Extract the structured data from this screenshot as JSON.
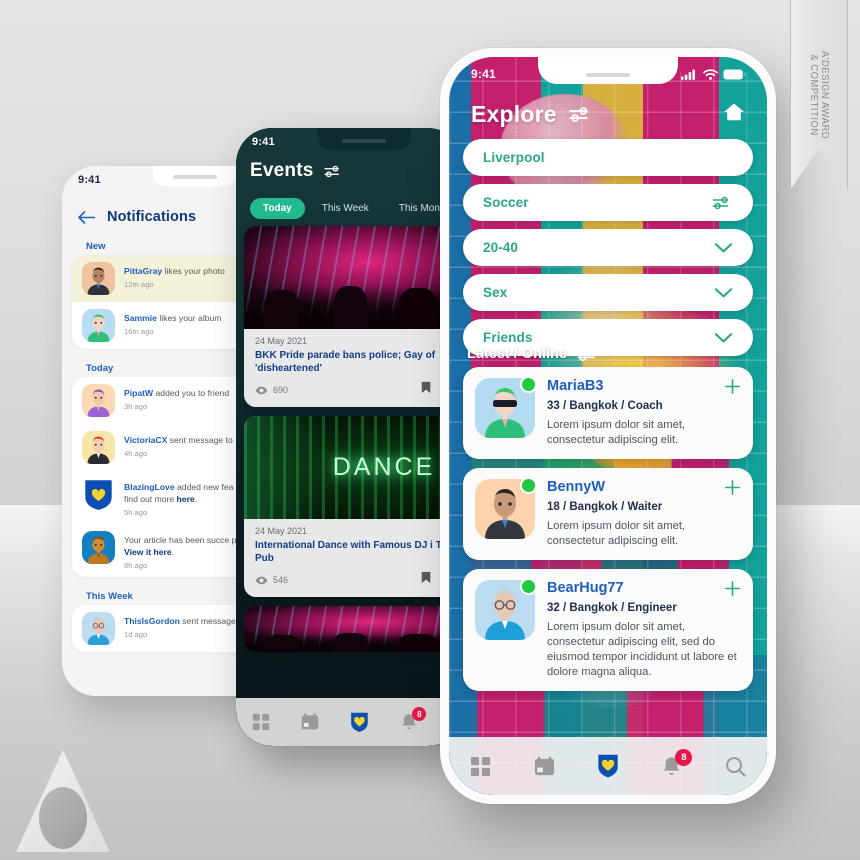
{
  "award_ribbon": {
    "line1": "A'DESIGN AWARD",
    "line2": "& COMPETITION"
  },
  "brand_logo": "a-logo",
  "phone_notifications": {
    "status_time": "9:41",
    "back_icon": "back-arrow-icon",
    "title": "Notifications",
    "sections": [
      {
        "label": "New",
        "items": [
          {
            "actor": "PittaGray",
            "text": " likes your photo",
            "time": "12m ago",
            "avatar": "avatar-businessman",
            "highlight": true,
            "link": "",
            "tail": ""
          },
          {
            "actor": "Sammie",
            "text": " likes your album",
            "time": "16m ago",
            "avatar": "avatar-green-hair",
            "highlight": false,
            "link": "",
            "tail": ""
          }
        ]
      },
      {
        "label": "Today",
        "items": [
          {
            "actor": "PipatW",
            "text": " added you to friend",
            "time": "3h ago",
            "avatar": "avatar-purple-glasses",
            "highlight": false,
            "link": "",
            "tail": ""
          },
          {
            "actor": "VictoriaCX",
            "text": " sent message to",
            "time": "4h ago",
            "avatar": "avatar-red-cap",
            "highlight": false,
            "link": "",
            "tail": ""
          },
          {
            "actor": "BlazingLove",
            "text": " added new fea",
            "time": "5h ago",
            "avatar": "avatar-app-shield",
            "highlight": false,
            "link": "here",
            "tail": "find out more ",
            "tail_end": "."
          },
          {
            "actor": "",
            "text": "Your article has been succe published. ",
            "time": "8h ago",
            "avatar": "avatar-dog",
            "highlight": false,
            "link": "View it here",
            "tail": "",
            "tail_end": "."
          }
        ]
      },
      {
        "label": "This Week",
        "items": [
          {
            "actor": "ThisIsGordon",
            "text": " sent message",
            "time": "1d ago",
            "avatar": "avatar-glasses-blue-shirt",
            "highlight": false,
            "link": "",
            "tail": ""
          }
        ]
      }
    ]
  },
  "phone_events": {
    "status_time": "9:41",
    "title": "Events",
    "filter_icon": "sliders-icon",
    "tabs": [
      {
        "label": "Today",
        "active": true
      },
      {
        "label": "This Week",
        "active": false
      },
      {
        "label": "This Month",
        "active": false
      }
    ],
    "cards": [
      {
        "date": "24 May 2021",
        "title": "BKK Pride parade bans police; Gay of 'disheartened'",
        "views": "690",
        "image": "nightclub-pink-lights",
        "view_icon": "eye-icon",
        "bookmark_icon": "bookmark-icon",
        "heart_icon": "heart-icon"
      },
      {
        "date": "24 May 2021",
        "title": "International Dance with Famous DJ i Taurus Pub",
        "views": "546",
        "image": "dance-neon-green",
        "view_icon": "eye-icon",
        "bookmark_icon": "bookmark-icon",
        "heart_icon": "heart-icon"
      }
    ],
    "tabbar": [
      {
        "icon": "grid-icon",
        "active": false,
        "badge": ""
      },
      {
        "icon": "calendar-icon",
        "active": false,
        "badge": ""
      },
      {
        "icon": "heart-shield-icon",
        "active": true,
        "badge": ""
      },
      {
        "icon": "bell-icon",
        "active": false,
        "badge": "8"
      }
    ]
  },
  "phone_explore": {
    "status_time": "9:41",
    "status_icons": [
      "cellular-signal-icon",
      "wifi-icon",
      "battery-icon"
    ],
    "title": "Explore",
    "filter_icon": "sliders-icon",
    "home_icon": "home-icon",
    "filters": [
      {
        "label": "Liverpool",
        "icon": ""
      },
      {
        "label": "Soccer",
        "icon": "sliders-icon"
      },
      {
        "label": "20-40",
        "icon": "chevron-down-icon"
      },
      {
        "label": "Sex",
        "icon": "chevron-down-icon"
      },
      {
        "label": "Friends",
        "icon": "chevron-down-icon"
      }
    ],
    "section_title": "Latest / Online",
    "section_icon": "sliders-icon",
    "users": [
      {
        "name": "MariaB3",
        "meta": "33 / Bangkok / Coach",
        "desc": "Lorem ipsum dolor sit amet, consectetur adipiscing elit.",
        "avatar": "avatar-green-hair-sunglasses",
        "online": true,
        "add_icon": "plus-icon"
      },
      {
        "name": "BennyW",
        "meta": "18 / Bangkok / Waiter",
        "desc": "Lorem ipsum dolor sit amet, consectetur adipiscing elit.",
        "avatar": "avatar-businessman-suit",
        "online": true,
        "add_icon": "plus-icon"
      },
      {
        "name": "BearHug77",
        "meta": "32 / Bangkok / Engineer",
        "desc": "Lorem ipsum dolor sit amet, consectetur adipiscing elit, sed do eiusmod tempor incididunt ut labore et dolore magna aliqua.",
        "avatar": "avatar-glasses-blue-polo",
        "online": true,
        "add_icon": "plus-icon"
      }
    ],
    "tabbar": [
      {
        "icon": "grid-icon",
        "active": false,
        "badge": ""
      },
      {
        "icon": "calendar-icon",
        "active": false,
        "badge": ""
      },
      {
        "icon": "heart-shield-icon",
        "active": true,
        "badge": ""
      },
      {
        "icon": "bell-icon",
        "active": false,
        "badge": "8"
      },
      {
        "icon": "search-icon",
        "active": false,
        "badge": ""
      }
    ]
  },
  "colors": {
    "accent_teal": "#2aa883",
    "accent_blue": "#1f5fbf",
    "deep_blue": "#12397e",
    "badge_red": "#e8174a",
    "online_green": "#22c93f",
    "events_pill": "#23b98e",
    "wall_magenta": "#c4206e",
    "wall_teal": "#14a39c",
    "wall_yellow": "#d9b13f",
    "wall_blue": "#1b6fa8"
  }
}
